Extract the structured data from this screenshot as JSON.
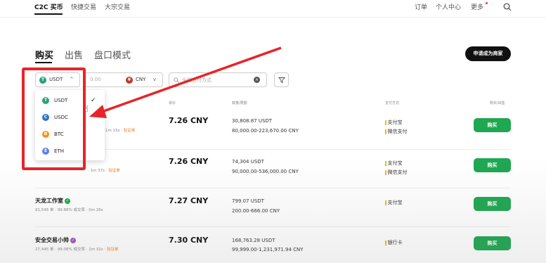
{
  "topnav": {
    "tabs": [
      {
        "label": "C2C 买币"
      },
      {
        "label": "快捷交易"
      },
      {
        "label": "大宗交易"
      }
    ],
    "right": [
      {
        "label": "订单"
      },
      {
        "label": "个人中心"
      },
      {
        "label": "更多"
      }
    ]
  },
  "trade_tabs": [
    {
      "label": "购买"
    },
    {
      "label": "出售"
    },
    {
      "label": "盘口模式"
    }
  ],
  "merchant_button": "申请成为商家",
  "filters": {
    "coin": "USDT",
    "amount_placeholder": "0.00",
    "fiat": "CNY",
    "payment_placeholder": "全部支付方式"
  },
  "table_headers": {
    "price": "单价",
    "amount": "数量/限额",
    "payment": "支付方式",
    "action": "购买/出售"
  },
  "coin_dropdown": [
    {
      "label": "USDT",
      "color": "#26a17b",
      "glyph": "T"
    },
    {
      "label": "USDC",
      "color": "#2775ca",
      "glyph": "C"
    },
    {
      "label": "BTC",
      "color": "#f7931a",
      "glyph": "B"
    },
    {
      "label": "ETH",
      "color": "#627eea",
      "glyph": "E"
    }
  ],
  "rows": [
    {
      "name": "",
      "stats": "1m 15s",
      "badge": "验证单",
      "price": "7.26 CNY",
      "amount": "30,808.87 USDT",
      "limit": "80,000.00-223,670.00 CNY",
      "payments": [
        "支付宝",
        "微信支付"
      ],
      "action": "购买"
    },
    {
      "name": "",
      "stats": "1m 37s",
      "badge": "验证单",
      "price": "7.26 CNY",
      "amount": "74,304 USDT",
      "limit": "90,000.00-536,000.00 CNY",
      "payments": [
        "支付宝",
        "微信支付"
      ],
      "action": "购买"
    },
    {
      "name": "天龙工作室",
      "stats": "91,546 单 · 99.88% 成交率 · 0m 26s",
      "badge": "",
      "price": "7.27 CNY",
      "amount": "799.07 USDT",
      "limit": "200.00-666.00 CNY",
      "payments": [
        "支付宝"
      ],
      "action": "购买"
    },
    {
      "name": "安全交易小帅",
      "stats": "27,445 单 · 99.08% 成交率 · 1m 32s",
      "badge": "验证单",
      "price": "7.30 CNY",
      "amount": "168,763.28 USDT",
      "limit": "99,999.00-1,231,971.94 CNY",
      "payments": [
        "银行卡"
      ],
      "action": "购买"
    }
  ],
  "colors": {
    "accent_green": "#1fa751",
    "highlight_red": "#e5252a"
  }
}
